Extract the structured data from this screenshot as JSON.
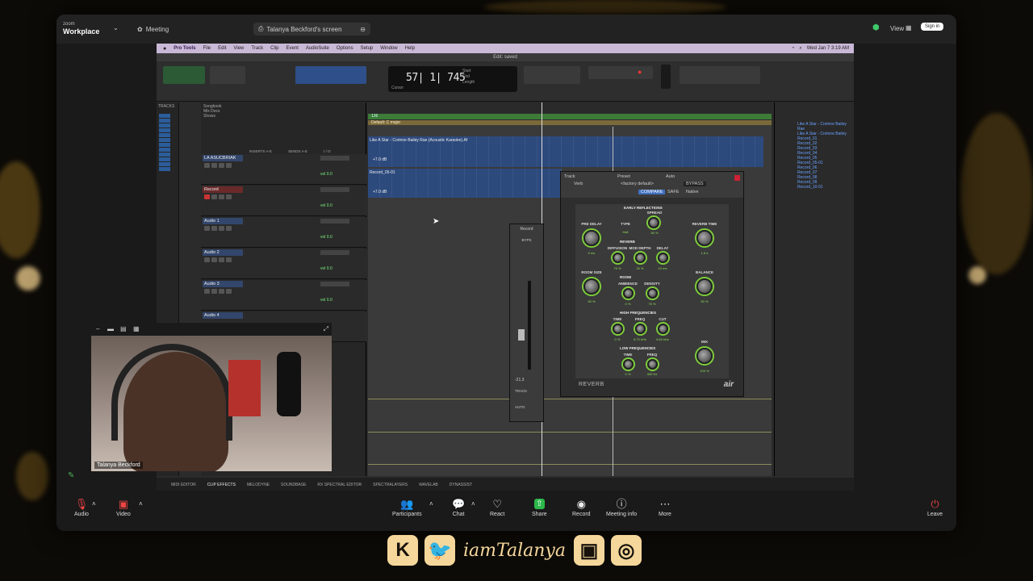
{
  "zoom": {
    "brand_top": "zoom",
    "brand": "Workplace",
    "tab_meeting": "Meeting",
    "tab_screen": "Talanya Beckford's screen",
    "view_label": "View",
    "signin_label": "Sign in",
    "toolbar": {
      "audio": "Audio",
      "video": "Video",
      "participants": "Participants",
      "chat": "Chat",
      "react": "React",
      "share": "Share",
      "record": "Record",
      "meeting_info": "Meeting info",
      "more": "More",
      "leave": "Leave"
    }
  },
  "mac_menu": {
    "app": "Pro Tools",
    "items": [
      "File",
      "Edit",
      "View",
      "Track",
      "Clip",
      "Event",
      "AudioSuite",
      "Options",
      "Setup",
      "Window",
      "Help"
    ],
    "clock": "Wed Jan 7 3:19 AM"
  },
  "protools": {
    "title": "Edit: saved",
    "counter": "57| 1| 745",
    "counter_labels": {
      "start": "Start",
      "end": "End",
      "length": "Length",
      "cursor": "Cursor"
    },
    "tracks_header": "TRACKS",
    "groups": [
      "Songbook",
      "Mix Docs",
      "Shows"
    ],
    "inserts_header": "INSERTS A-E",
    "sends_header": "SENDS A-E",
    "io_header": "I / O",
    "tracks": [
      {
        "name": "LA ASUCBRIAK",
        "vol": "vol 0.0"
      },
      {
        "name": "Record",
        "vol": "vol 0.0"
      },
      {
        "name": "Audio 1",
        "vol": "vol 0.0"
      },
      {
        "name": "Audio 2",
        "vol": "vol 0.0"
      },
      {
        "name": "Audio 3",
        "vol": "vol 0.0"
      },
      {
        "name": "Audio 4",
        "vol": ""
      }
    ],
    "clip1_name": "Like A Star - Corinne Bailey Rae (Acoustic Karaoke).Af",
    "clip2_name": "Record_05-01",
    "marker_label": "136",
    "key_label": "Default: C major",
    "clip_volume_1": "+7.0 dB",
    "clip_volume_2": "+7.0 dB",
    "clips_list": [
      "Like A Star - Corinne Bailey Rae",
      "Like A Star - Corinne Bailey",
      "Record_01",
      "Record_02",
      "Record_03",
      "Record_04",
      "Record_05",
      "Record_05-01",
      "Record_06",
      "Record_07",
      "Record_08",
      "Record_09",
      "Record_10-01"
    ],
    "bottom_tabs": [
      "MIDI EDITOR",
      "CLIP EFFECTS",
      "MELODYNE",
      "SOUNDBASE",
      "RX SPECTRAL EDITOR",
      "SPECTRALAYERS",
      "WAVELAB",
      "DYNASSIST"
    ],
    "insert_win": {
      "track": "Record",
      "bypass": "BYPS",
      "value": "-21.3",
      "track_btn": "TRACK",
      "auto_btn": "AUTO"
    }
  },
  "reverb": {
    "header": {
      "track": "Track",
      "preset": "Preset",
      "auto": "Auto",
      "track_name": "Verb",
      "preset_value": "<factory default>",
      "compare": "COMPARE",
      "safe": "SAFE",
      "bypass": "BYPASS",
      "native": "Native"
    },
    "sections": {
      "early": "EARLY REFLECTIONS",
      "reverb": "REVERB",
      "room": "ROOM",
      "high": "HIGH FREQUENCIES",
      "low": "LOW FREQUENCIES"
    },
    "knobs": {
      "pre_delay": {
        "label": "PRE DELAY",
        "value": "0 ms"
      },
      "room_size": {
        "label": "ROOM SIZE",
        "value": "50 %"
      },
      "type": {
        "label": "TYPE",
        "value": "Hall"
      },
      "spread": {
        "label": "SPREAD",
        "value": "50 %"
      },
      "reverb_time": {
        "label": "REVERB TIME",
        "value": "1.8 s"
      },
      "diffusion": {
        "label": "DIFFUSION",
        "value": "75 %"
      },
      "mod_depth": {
        "label": "MOD DEPTH",
        "value": "20 %"
      },
      "decay": {
        "label": "DELAY",
        "value": "10 ms"
      },
      "balance": {
        "label": "BALANCE",
        "value": "50 %"
      },
      "ambience": {
        "label": "AMBIENCE",
        "value": "0 %"
      },
      "density": {
        "label": "DENSITY",
        "value": "75 %"
      },
      "mix": {
        "label": "MIX",
        "value": "100 %"
      },
      "hf_time": {
        "label": "TIME",
        "value": "0 %"
      },
      "hf_freq": {
        "label": "FREQ",
        "value": "8.72 kHz"
      },
      "hf_cut": {
        "label": "CUT",
        "value": "9.60 kHz"
      },
      "lf_time": {
        "label": "TIME",
        "value": "0 %"
      },
      "lf_freq": {
        "label": "FREQ",
        "value": "300 Hz"
      }
    },
    "name": "REVERB",
    "logo": "air"
  },
  "webcam": {
    "name": "Talanya Beckford"
  },
  "overlay": {
    "handle": "iamTalanya"
  }
}
